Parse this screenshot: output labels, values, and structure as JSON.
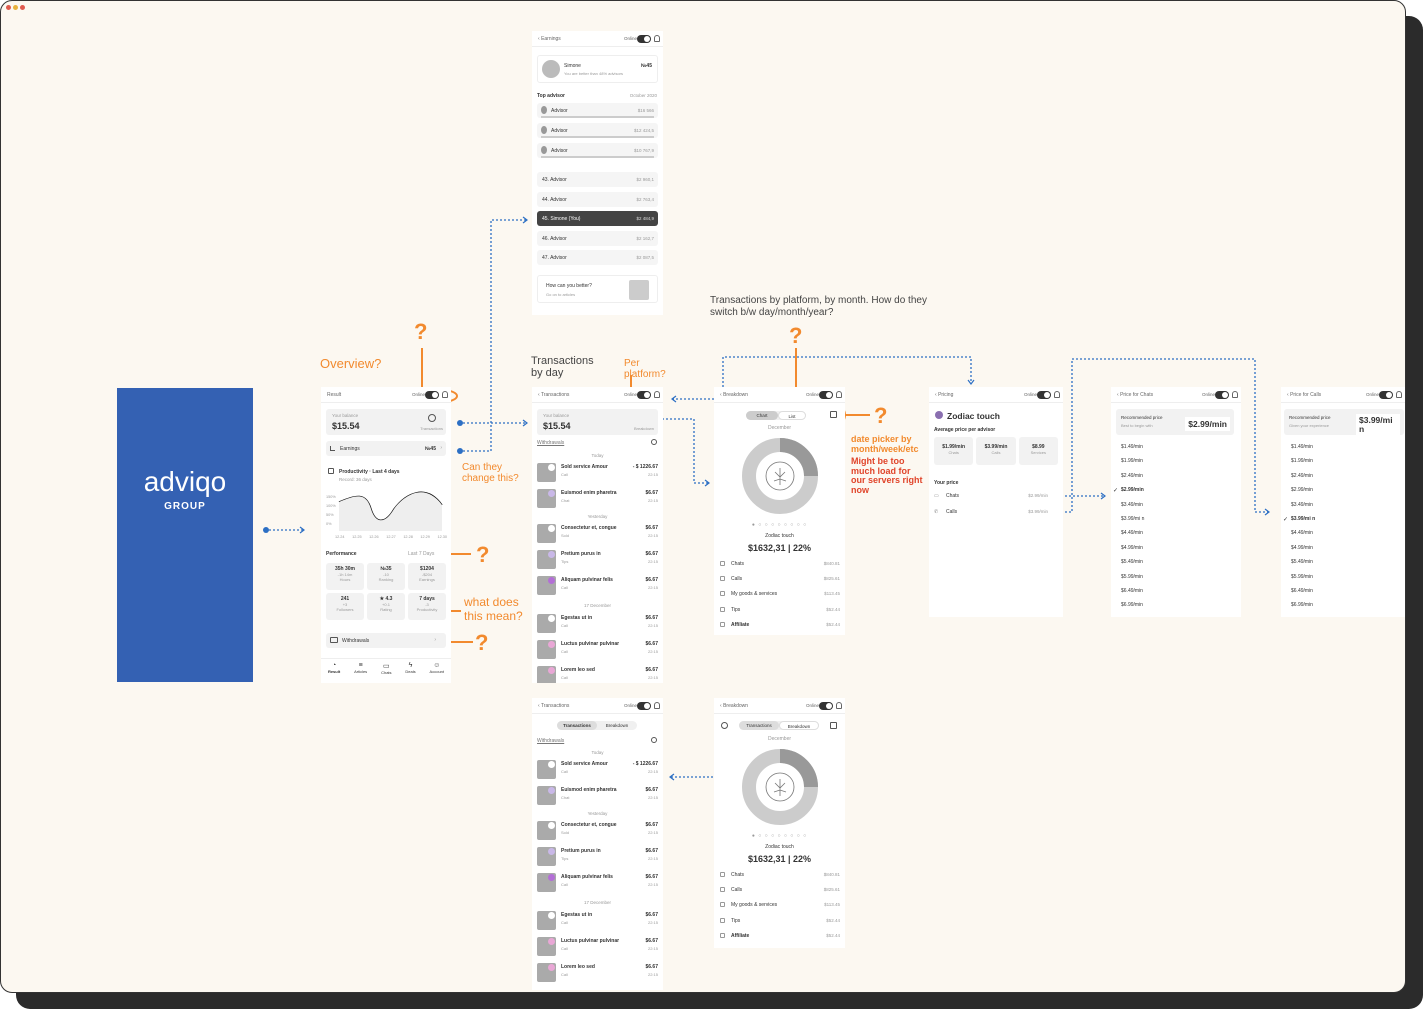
{
  "window": {
    "dot_colors": [
      "#e05a4e",
      "#e8b23d",
      "#e05a4e"
    ]
  },
  "logo": {
    "name": "adviqo",
    "sub": "GROUP",
    "bg": "#3461b3"
  },
  "annotations": {
    "overview": "Overview?",
    "can_they": "Can they change this?",
    "what_does": "what does this mean?",
    "per_platform": "Per platform?",
    "transactions_by_day": "Transactions by day",
    "tx_platform_note": "Transactions by platform, by month. How do they switch b/w day/month/year?",
    "date_picker": "date picker by month/week/etc",
    "server_load": "Might be too much load for our servers right now",
    "q": "?"
  },
  "result": {
    "title": "Result",
    "online": "Online",
    "balance_label": "Your balance",
    "balance": "$15.54",
    "transactions_label": "Transactions",
    "earnings_label": "Earnings",
    "earnings_rank": "№45",
    "productivity_title": "Productivity · Last 4 days",
    "productivity_sub": "Record: 36 days",
    "y_ticks": [
      "150%",
      "100%",
      "50%",
      "0%"
    ],
    "x_ticks": [
      "12.24",
      "12.25",
      "12.26",
      "12.27",
      "12.28",
      "12.29",
      "12.30"
    ],
    "performance": "Performance",
    "period": "Last 7 Days",
    "stats": [
      {
        "v": "35h 30m",
        "d": "-1h 14m",
        "l": "Hours"
      },
      {
        "v": "№35",
        "d": "-10",
        "l": "Ranking"
      },
      {
        "v": "$1204",
        "d": "-$204",
        "l": "Earnings"
      },
      {
        "v": "241",
        "d": "+3",
        "l": "Followers"
      },
      {
        "v": "★ 4.3",
        "d": "+0.1",
        "l": "Rating"
      },
      {
        "v": "7 days",
        "d": "-3",
        "l": "Productivity"
      }
    ],
    "withdrawals": "Withdrawals",
    "nav": [
      "Result",
      "Articles",
      "Chats",
      "Deals",
      "Account"
    ]
  },
  "earnings": {
    "title": "Earnings",
    "online": "Online",
    "user": "Simone",
    "user_sub": "You are better than 48% advisors",
    "rank": "№45",
    "top_label": "Top advisor",
    "period": "October 2020",
    "top": [
      {
        "n": "Advisor",
        "v": "$16 566"
      },
      {
        "n": "Advisor",
        "v": "$12 424,5"
      },
      {
        "n": "Advisor",
        "v": "$10 767,9"
      }
    ],
    "list": [
      {
        "n": "43. Advisor",
        "v": "$2 960,1"
      },
      {
        "n": "44. Advisor",
        "v": "$2 763,4"
      },
      {
        "n": "45. Simone (You)",
        "v": "$2 484,9"
      },
      {
        "n": "46. Advisor",
        "v": "$2 162,7"
      },
      {
        "n": "47. Advisor",
        "v": "$2 087,5"
      }
    ],
    "better_title": "How can you better?",
    "better_sub": "Go on to articles"
  },
  "transactions": {
    "title": "Transactions",
    "online": "Online",
    "balance_label": "Your balance",
    "balance": "$15.54",
    "breakdown": "Breakdown",
    "withdrawals": "Withdrawals",
    "tab_transactions": "Transactions",
    "tab_breakdown": "Breakdown",
    "days": [
      "Today",
      "Yesterday",
      "17 December"
    ],
    "rows": [
      {
        "n": "Sold service Amour",
        "s": "Call",
        "a": "- $ 1226.67",
        "t": "22:15"
      },
      {
        "n": "Euismod enim pharetra",
        "s": "Chat",
        "a": "$6.67",
        "t": "22:15"
      },
      {
        "n": "Consectetur et, congue",
        "s": "Sold",
        "a": "$6.67",
        "t": "22:15"
      },
      {
        "n": "Pretium purus in",
        "s": "Tips",
        "a": "$6.67",
        "t": "22:15"
      },
      {
        "n": "Aliquam pulvinar felis",
        "s": "Call",
        "a": "$6.67",
        "t": "22:15"
      },
      {
        "n": "Egestas ut in",
        "s": "Call",
        "a": "$6.67",
        "t": "22:15"
      },
      {
        "n": "Luctus pulvinar pulvinar",
        "s": "Call",
        "a": "$6.67",
        "t": "22:15"
      },
      {
        "n": "Lorem leo sed",
        "s": "Call",
        "a": "$6.67",
        "t": "22:15"
      }
    ]
  },
  "breakdown": {
    "title": "Breakdown",
    "online": "Online",
    "chart": "Chart",
    "list": "List",
    "month": "December",
    "label": "Zodiac touch",
    "total": "$1632,31",
    "pct": "22%",
    "cats": [
      {
        "n": "Chats",
        "v": "$840.81"
      },
      {
        "n": "Calls",
        "v": "$825.61"
      },
      {
        "n": "My goods & services",
        "v": "$113.45"
      },
      {
        "n": "Tips",
        "v": "$52.44"
      },
      {
        "n": "Affiliate",
        "v": "$52.44"
      }
    ]
  },
  "pricing": {
    "title": "Pricing",
    "online": "Online",
    "brand": "Zodiac touch",
    "avg_label": "Average price per advisor",
    "avg": [
      {
        "v": "$1.99/min",
        "l": "Chats"
      },
      {
        "v": "$3.99/min",
        "l": "Calls"
      },
      {
        "v": "$8.99",
        "l": "Services"
      }
    ],
    "your_price": "Your price",
    "chats": "Chats",
    "chats_v": "$2.99/min",
    "calls": "Calls",
    "calls_v": "$3.99/min"
  },
  "price_chats": {
    "title": "Price for Chats",
    "online": "Online",
    "rec_label": "Recommended price",
    "rec_sub": "Best to begin with",
    "rec": "$2.99/min",
    "items": [
      "$1.49/min",
      "$1.99/min",
      "$2.49/min",
      "$2.99/min",
      "$3.49/min",
      "$3.99/mi n",
      "$4.49/min",
      "$4.99/min",
      "$5.49/min",
      "$5.99/min",
      "$6.49/min",
      "$6.99/min"
    ],
    "selected": 3
  },
  "price_calls": {
    "title": "Price for Calls",
    "online": "Online",
    "rec_label": "Recommended price",
    "rec_sub": "Given your experience",
    "rec": "$3.99/mi n",
    "items": [
      "$1.49/min",
      "$1.99/min",
      "$2.49/min",
      "$2.99/min",
      "$3.49/min",
      "$3.99/mi n",
      "$4.49/min",
      "$4.99/min",
      "$5.49/min",
      "$5.99/min",
      "$6.49/min",
      "$6.99/min"
    ],
    "selected": 5
  }
}
